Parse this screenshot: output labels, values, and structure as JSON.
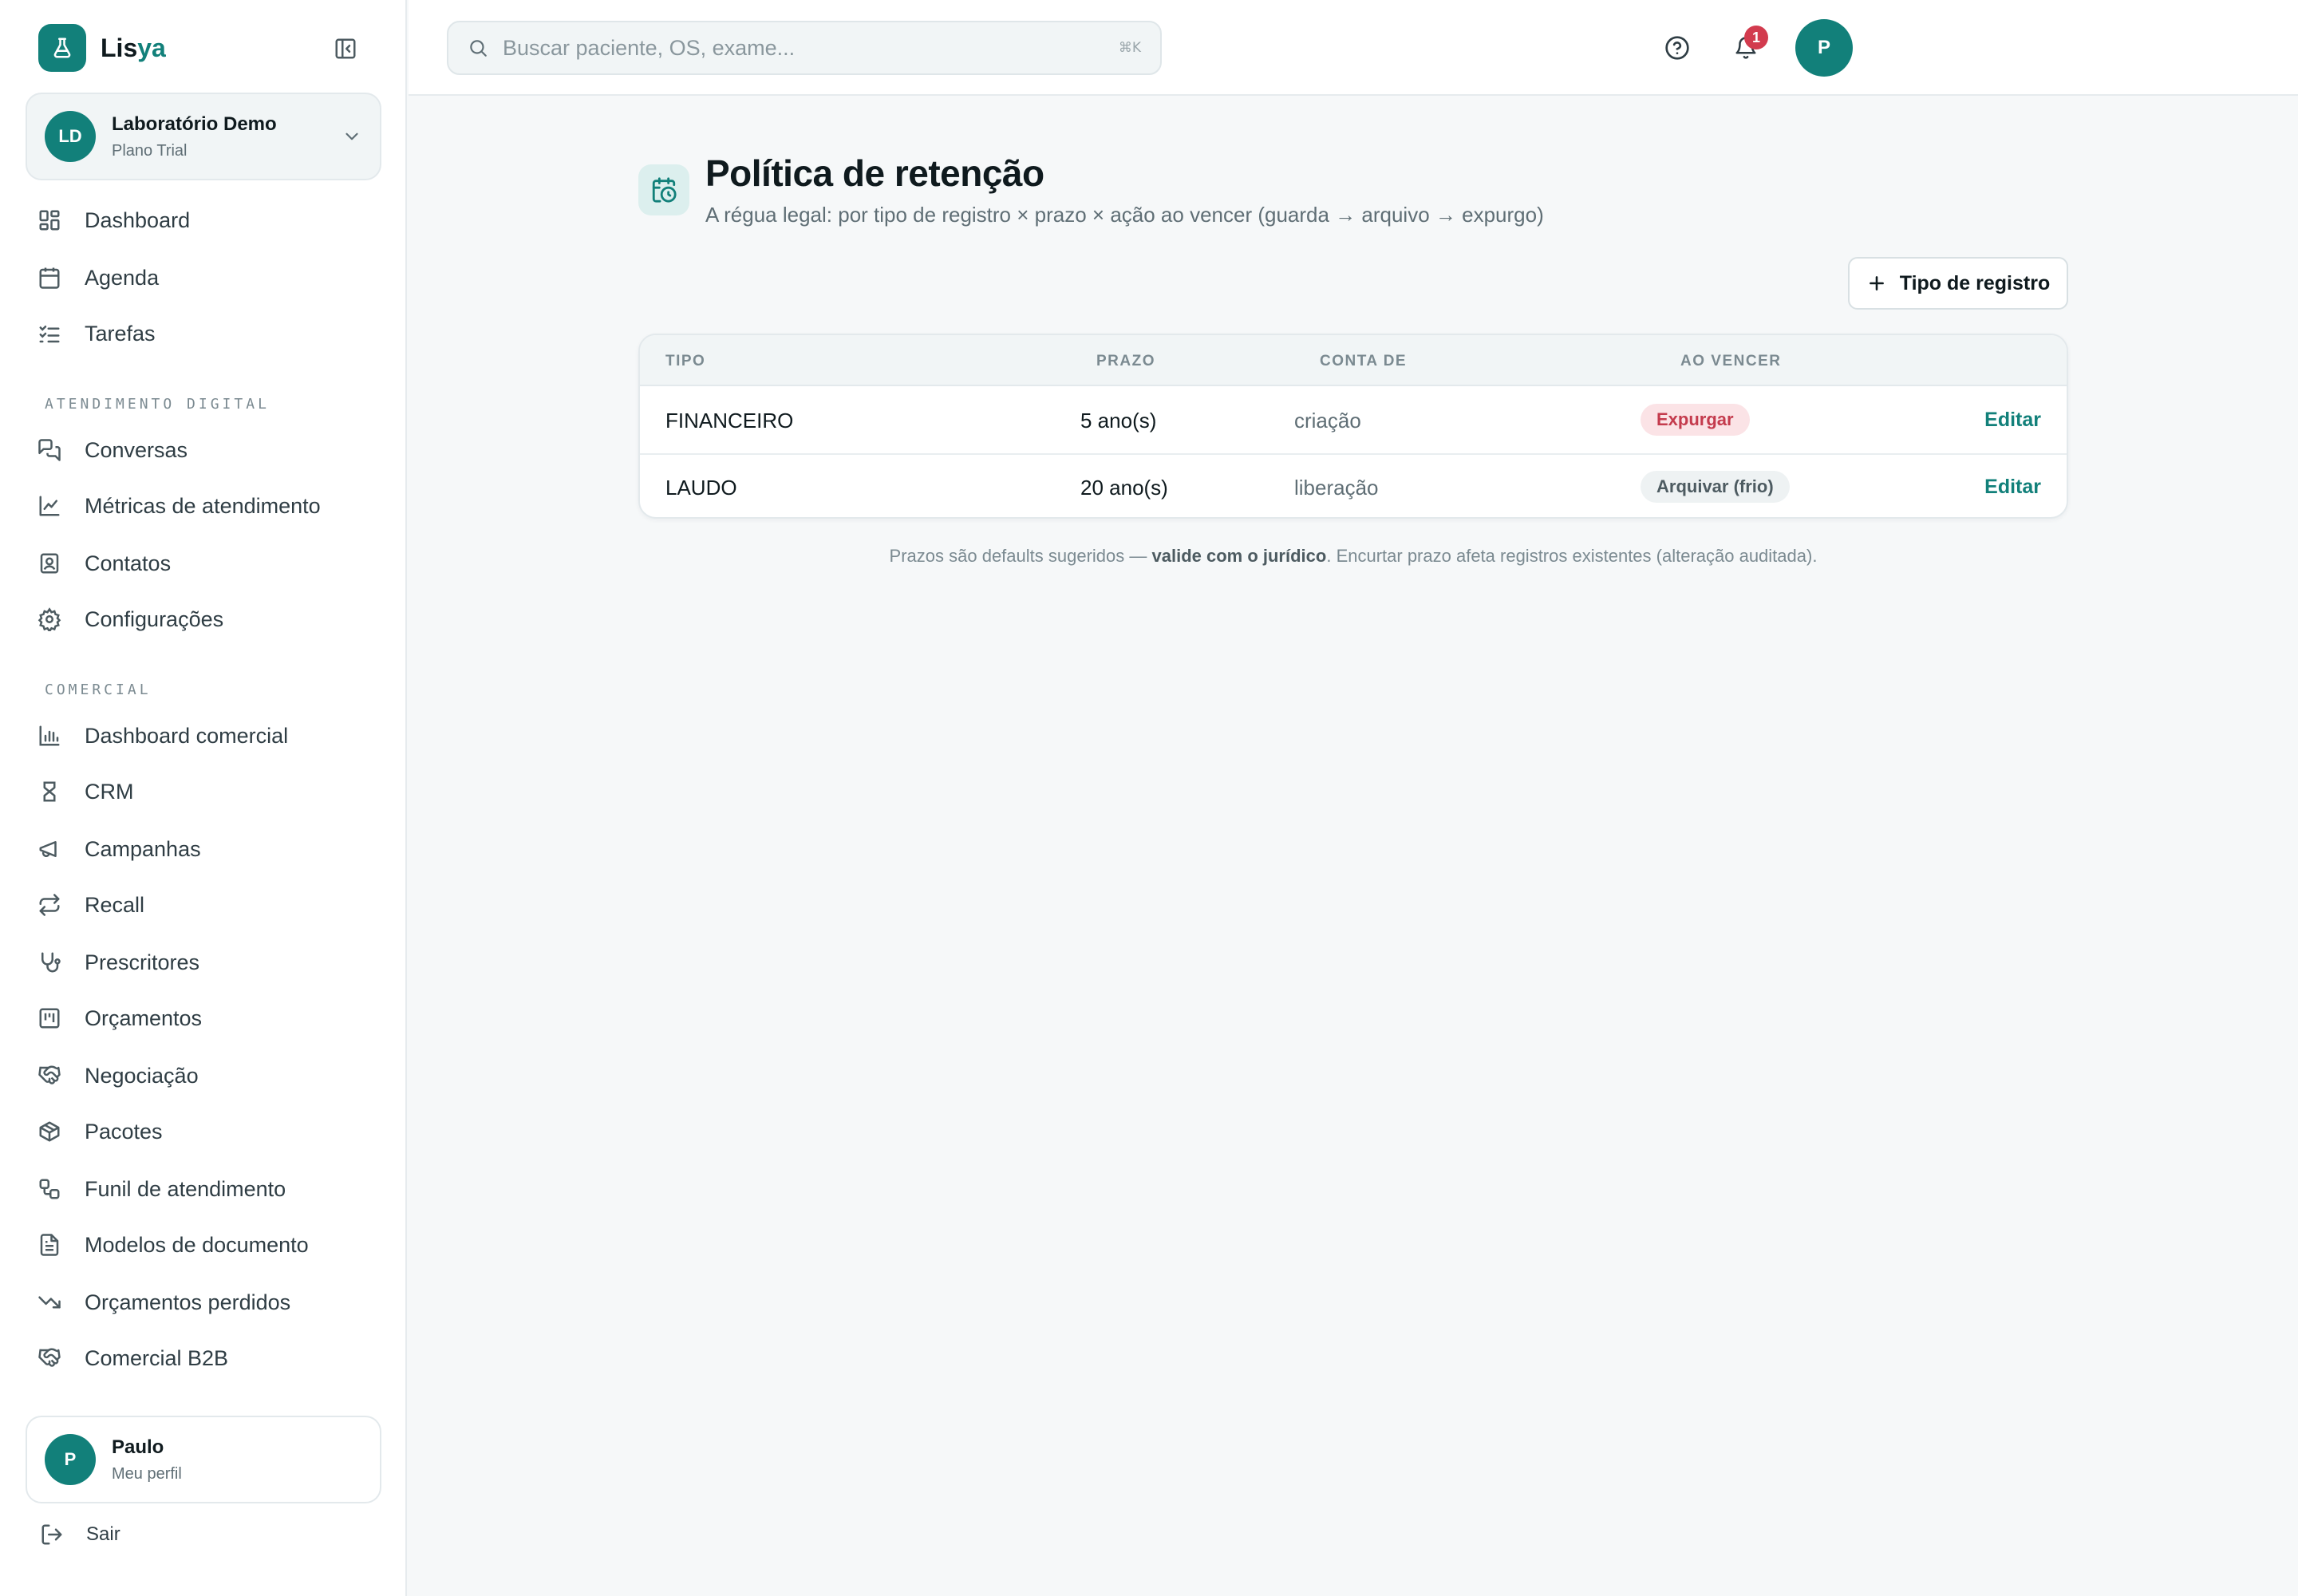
{
  "brand": {
    "name_main": "Lis",
    "name_accent": "ya"
  },
  "org": {
    "initials": "LD",
    "name": "Laboratório Demo",
    "plan": "Plano Trial"
  },
  "nav": {
    "main": [
      {
        "label": "Dashboard",
        "icon": "dashboard-icon"
      },
      {
        "label": "Agenda",
        "icon": "calendar-icon"
      },
      {
        "label": "Tarefas",
        "icon": "checklist-icon"
      }
    ],
    "section1_title": "ATENDIMENTO DIGITAL",
    "section1": [
      {
        "label": "Conversas",
        "icon": "chat-icon"
      },
      {
        "label": "Métricas de atendimento",
        "icon": "line-chart-icon"
      },
      {
        "label": "Contatos",
        "icon": "contact-icon"
      },
      {
        "label": "Configurações",
        "icon": "gear-icon"
      }
    ],
    "section2_title": "COMERCIAL",
    "section2": [
      {
        "label": "Dashboard comercial",
        "icon": "bar-chart-icon"
      },
      {
        "label": "CRM",
        "icon": "crm-icon"
      },
      {
        "label": "Campanhas",
        "icon": "megaphone-icon"
      },
      {
        "label": "Recall",
        "icon": "repeat-icon"
      },
      {
        "label": "Prescritores",
        "icon": "stethoscope-icon"
      },
      {
        "label": "Orçamentos",
        "icon": "kanban-icon"
      },
      {
        "label": "Negociação",
        "icon": "handshake-icon"
      },
      {
        "label": "Pacotes",
        "icon": "package-icon"
      },
      {
        "label": "Funil de atendimento",
        "icon": "workflow-icon"
      },
      {
        "label": "Modelos de documento",
        "icon": "document-icon"
      },
      {
        "label": "Orçamentos perdidos",
        "icon": "trending-down-icon"
      },
      {
        "label": "Comercial B2B",
        "icon": "handshake-icon"
      }
    ]
  },
  "user": {
    "initial": "P",
    "name": "Paulo",
    "subtitle": "Meu perfil"
  },
  "logout_label": "Sair",
  "search": {
    "placeholder": "Buscar paciente, OS, exame...",
    "shortcut": "⌘K"
  },
  "notifications": {
    "count": "1"
  },
  "top_avatar": "P",
  "page": {
    "title": "Política de retenção",
    "subtitle": "A régua legal: por tipo de registro × prazo × ação ao vencer (guarda → arquivo → expurgo)",
    "add_button": "Tipo de registro"
  },
  "table": {
    "headers": [
      "TIPO",
      "PRAZO",
      "CONTA DE",
      "AO VENCER"
    ],
    "rows": [
      {
        "tipo": "FINANCEIRO",
        "prazo": "5 ano(s)",
        "conta_de": "criação",
        "ao_vencer": "Expurgar",
        "action": "Editar"
      },
      {
        "tipo": "LAUDO",
        "prazo": "20 ano(s)",
        "conta_de": "liberação",
        "ao_vencer": "Arquivar (frio)",
        "action": "Editar"
      }
    ]
  },
  "footnote": {
    "before": "Prazos são defaults sugeridos — ",
    "bold": "valide com o jurídico",
    "after": ". Encurtar prazo afeta registros existentes (alteração auditada)."
  },
  "colors": {
    "accent": "#12807a",
    "danger": "#c43b4d",
    "badge_danger_bg": "#fbe3e6"
  }
}
